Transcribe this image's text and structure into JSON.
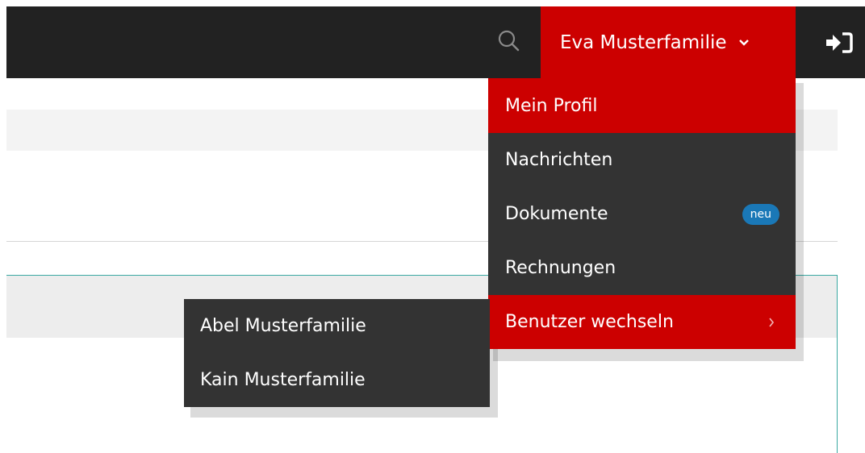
{
  "header": {
    "user_name": "Eva Musterfamilie",
    "icons": [
      "search-icon",
      "chevron-down-icon",
      "sign-in-icon"
    ]
  },
  "user_menu": {
    "items": [
      {
        "label": "Mein Profil"
      },
      {
        "label": "Nachrichten"
      },
      {
        "label": "Dokumente",
        "badge": "neu"
      },
      {
        "label": "Rechnungen"
      },
      {
        "label": "Benutzer wechseln"
      }
    ]
  },
  "switch_user_menu": {
    "items": [
      {
        "label": "Abel Musterfamilie"
      },
      {
        "label": "Kain Musterfamilie"
      }
    ]
  },
  "colors": {
    "accent": "#cc0000",
    "topbar": "#222222",
    "menu_bg": "#333333",
    "badge": "#1a78b7",
    "panel_border": "#3aa9a2"
  }
}
